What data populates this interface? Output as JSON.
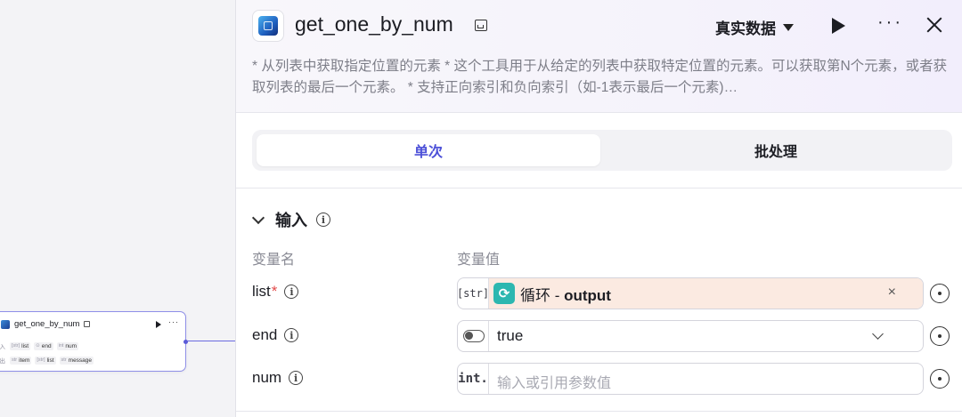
{
  "canvas": {
    "node": {
      "title": "get_one_by_num",
      "input_label": "输入",
      "output_label": "输出",
      "inputs": [
        {
          "type": "[str]",
          "name": "list"
        },
        {
          "type": "⊙",
          "name": "end"
        },
        {
          "type": "int",
          "name": "num"
        }
      ],
      "outputs": [
        {
          "type": "str",
          "name": "item"
        },
        {
          "type": "[str]",
          "name": "list"
        },
        {
          "type": "str",
          "name": "message"
        }
      ],
      "play_icon": "play-icon",
      "more_icon": "more-icon"
    }
  },
  "panel": {
    "title": "get_one_by_num",
    "mode": "真实数据",
    "description": "* 从列表中获取指定位置的元素 * 这个工具用于从给定的列表中获取特定位置的元素。可以获取第N个元素，或者获取列表的最后一个元素。 * 支持正向索引和负向索引（如-1表示最后一个元素)…",
    "tabs": [
      {
        "label": "单次",
        "active": true
      },
      {
        "label": "批处理",
        "active": false
      }
    ],
    "section": {
      "title": "输入",
      "col_name": "变量名",
      "col_value": "变量值"
    },
    "vars": [
      {
        "name": "list",
        "required": "*",
        "type": "[str]",
        "ref_node": "循环",
        "ref_sep": " - ",
        "ref_field": "output",
        "clear": "×"
      },
      {
        "name": "end",
        "value": "true"
      },
      {
        "name": "num",
        "type": "int.",
        "placeholder": "输入或引用参数值"
      }
    ],
    "accent_color": "#4c50d8",
    "ref_bg_color": "#fbeae1"
  }
}
